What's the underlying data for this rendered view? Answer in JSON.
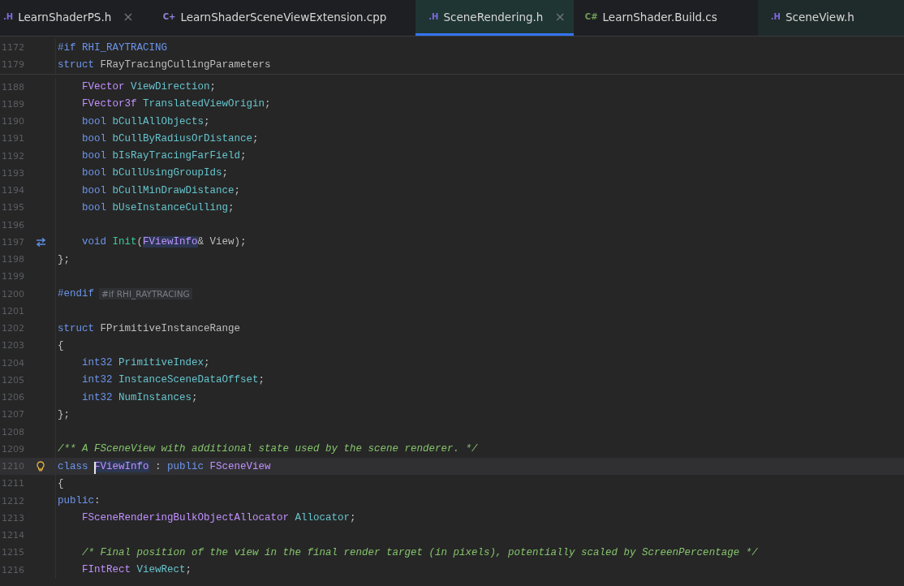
{
  "tabs": [
    {
      "badge": ".H",
      "kind": "h",
      "label": "LearnShaderPS.h",
      "close": "×",
      "selected": false
    },
    {
      "badge": "C+",
      "kind": "cpp",
      "label": "LearnShaderSceneViewExtension.cpp",
      "selected": false
    },
    {
      "badge": ".H",
      "kind": "h",
      "label": "SceneRendering.h",
      "close": "×",
      "selected": true
    },
    {
      "badge": "C#",
      "kind": "cs",
      "label": "LearnShader.Build.cs",
      "selected": false
    },
    {
      "badge": ".H",
      "kind": "h",
      "label": "SceneView.h",
      "selected": false
    }
  ],
  "sticky_lines": [
    {
      "number": "1172",
      "indented": false,
      "tokens": [
        {
          "text": "#if ",
          "kind": "keyword"
        },
        {
          "text": "RHI_RAYTRACING",
          "kind": "keyword"
        }
      ]
    },
    {
      "number": "1179",
      "indented": false,
      "tokens": [
        {
          "text": "struct ",
          "kind": "keyword"
        },
        {
          "text": "FRayTracingCullingParameters",
          "kind": "plain"
        }
      ]
    }
  ],
  "lines": [
    {
      "number": "1188",
      "indented": true,
      "tokens": [
        {
          "text": "FVector ",
          "kind": "type"
        },
        {
          "text": "ViewDirection",
          "kind": "field"
        },
        {
          "text": ";",
          "kind": "plain"
        }
      ]
    },
    {
      "number": "1189",
      "indented": true,
      "tokens": [
        {
          "text": "FVector3f ",
          "kind": "type"
        },
        {
          "text": "TranslatedViewOrigin",
          "kind": "field"
        },
        {
          "text": ";",
          "kind": "plain"
        }
      ]
    },
    {
      "number": "1190",
      "indented": true,
      "tokens": [
        {
          "text": "bool ",
          "kind": "keyword"
        },
        {
          "text": "bCullAllObjects",
          "kind": "field"
        },
        {
          "text": ";",
          "kind": "plain"
        }
      ]
    },
    {
      "number": "1191",
      "indented": true,
      "tokens": [
        {
          "text": "bool ",
          "kind": "keyword"
        },
        {
          "text": "bCullByRadiusOrDistance",
          "kind": "field"
        },
        {
          "text": ";",
          "kind": "plain"
        }
      ]
    },
    {
      "number": "1192",
      "indented": true,
      "tokens": [
        {
          "text": "bool ",
          "kind": "keyword"
        },
        {
          "text": "bIsRayTracingFarField",
          "kind": "field"
        },
        {
          "text": ";",
          "kind": "plain"
        }
      ]
    },
    {
      "number": "1193",
      "indented": true,
      "tokens": [
        {
          "text": "bool ",
          "kind": "keyword"
        },
        {
          "text": "bCullUsingGroupIds",
          "kind": "field"
        },
        {
          "text": ";",
          "kind": "plain"
        }
      ]
    },
    {
      "number": "1194",
      "indented": true,
      "tokens": [
        {
          "text": "bool ",
          "kind": "keyword"
        },
        {
          "text": "bCullMinDrawDistance",
          "kind": "field"
        },
        {
          "text": ";",
          "kind": "plain"
        }
      ]
    },
    {
      "number": "1195",
      "indented": true,
      "tokens": [
        {
          "text": "bool ",
          "kind": "keyword"
        },
        {
          "text": "bUseInstanceCulling",
          "kind": "field"
        },
        {
          "text": ";",
          "kind": "plain"
        }
      ]
    },
    {
      "number": "1196"
    },
    {
      "number": "1197",
      "indented": true,
      "gutter": {
        "kind": "swap"
      },
      "tokens": [
        {
          "text": "void ",
          "kind": "keyword"
        },
        {
          "text": "Init",
          "kind": "func"
        },
        {
          "text": "(",
          "kind": "plain"
        },
        {
          "text": "FViewInfo",
          "kind": "type",
          "highlighted": true
        },
        {
          "text": "& View);",
          "kind": "plain"
        }
      ]
    },
    {
      "number": "1198",
      "indented": false,
      "tokens": [
        {
          "text": "};",
          "kind": "plain"
        }
      ]
    },
    {
      "number": "1199"
    },
    {
      "number": "1200",
      "indented": false,
      "tokens": [
        {
          "text": "#endif",
          "kind": "keyword"
        },
        {
          "text": "#if RHI_RAYTRACING",
          "kind": "hint"
        }
      ]
    },
    {
      "number": "1201"
    },
    {
      "number": "1202",
      "indented": false,
      "tokens": [
        {
          "text": "struct ",
          "kind": "keyword"
        },
        {
          "text": "FPrimitiveInstanceRange",
          "kind": "plain"
        }
      ]
    },
    {
      "number": "1203",
      "indented": false,
      "tokens": [
        {
          "text": "{",
          "kind": "plain"
        }
      ]
    },
    {
      "number": "1204",
      "indented": true,
      "tokens": [
        {
          "text": "int32 ",
          "kind": "keyword"
        },
        {
          "text": "PrimitiveIndex",
          "kind": "field"
        },
        {
          "text": ";",
          "kind": "plain"
        }
      ]
    },
    {
      "number": "1205",
      "indented": true,
      "tokens": [
        {
          "text": "int32 ",
          "kind": "keyword"
        },
        {
          "text": "InstanceSceneDataOffset",
          "kind": "field"
        },
        {
          "text": ";",
          "kind": "plain"
        }
      ]
    },
    {
      "number": "1206",
      "indented": true,
      "tokens": [
        {
          "text": "int32 ",
          "kind": "keyword"
        },
        {
          "text": "NumInstances",
          "kind": "field"
        },
        {
          "text": ";",
          "kind": "plain"
        }
      ]
    },
    {
      "number": "1207",
      "indented": false,
      "tokens": [
        {
          "text": "};",
          "kind": "plain"
        }
      ]
    },
    {
      "number": "1208"
    },
    {
      "number": "1209",
      "indented": false,
      "tokens": [
        {
          "text": "/** A FSceneView with additional state used by the scene renderer. */",
          "kind": "comment"
        }
      ]
    },
    {
      "number": "1210",
      "indented": false,
      "current": true,
      "gutter": {
        "kind": "bulb"
      },
      "tokens": [
        {
          "text": "class ",
          "kind": "keyword"
        },
        {
          "text": "FViewInfo",
          "kind": "type",
          "highlighted": true,
          "caret": true
        },
        {
          "text": " : ",
          "kind": "plain"
        },
        {
          "text": "public ",
          "kind": "keyword"
        },
        {
          "text": "FSceneView",
          "kind": "type"
        }
      ]
    },
    {
      "number": "1211",
      "indented": false,
      "tokens": [
        {
          "text": "{",
          "kind": "plain"
        }
      ]
    },
    {
      "number": "1212",
      "indented": false,
      "tokens": [
        {
          "text": "public",
          "kind": "keyword"
        },
        {
          "text": ":",
          "kind": "plain"
        }
      ]
    },
    {
      "number": "1213",
      "indented": true,
      "tokens": [
        {
          "text": "FSceneRenderingBulkObjectAllocator ",
          "kind": "type"
        },
        {
          "text": "Allocator",
          "kind": "field"
        },
        {
          "text": ";",
          "kind": "plain"
        }
      ]
    },
    {
      "number": "1214"
    },
    {
      "number": "1215",
      "indented": true,
      "tokens": [
        {
          "text": "/* Final position of the view in the final render target (in pixels), potentially scaled by ScreenPercentage */",
          "kind": "comment"
        }
      ]
    },
    {
      "number": "1216",
      "indented": true,
      "tokens": [
        {
          "text": "FIntRect ",
          "kind": "type"
        },
        {
          "text": "ViewRect",
          "kind": "field"
        },
        {
          "text": ";",
          "kind": "plain"
        }
      ]
    }
  ]
}
